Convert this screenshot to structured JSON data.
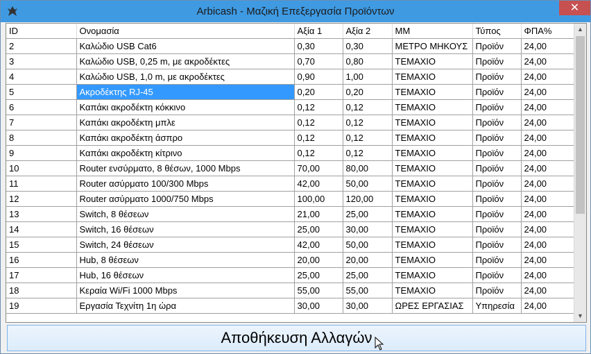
{
  "window": {
    "title": "Arbicash - Μαζική Επεξεργασία Προϊόντων",
    "close_symbol": "✕"
  },
  "grid": {
    "columns": [
      "ID",
      "Ονομασία",
      "Αξία 1",
      "Αξία 2",
      "ΜΜ",
      "Τύπος",
      "ΦΠΑ%"
    ],
    "rows": [
      [
        "2",
        "Καλώδιο USB Cat6",
        "0,30",
        "0,30",
        "ΜΕΤΡΟ ΜΗΚΟΥΣ",
        "Προϊόν",
        "24,00"
      ],
      [
        "3",
        "Καλώδιο USB, 0,25 m, με ακροδέκτες",
        "0,70",
        "0,80",
        "ΤΕΜΑΧΙΟ",
        "Προϊόν",
        "24,00"
      ],
      [
        "4",
        "Καλώδιο USB, 1,0 m, με ακροδέκτες",
        "0,90",
        "1,00",
        "ΤΕΜΑΧΙΟ",
        "Προϊόν",
        "24,00"
      ],
      [
        "5",
        "Ακροδέκτης RJ-45",
        "0,20",
        "0,20",
        "ΤΕΜΑΧΙΟ",
        "Προϊόν",
        "24,00"
      ],
      [
        "6",
        "Καπάκι ακροδέκτη κόκκινο",
        "0,12",
        "0,12",
        "ΤΕΜΑΧΙΟ",
        "Προϊόν",
        "24,00"
      ],
      [
        "7",
        "Καπάκι ακροδέκτη μπλε",
        "0,12",
        "0,12",
        "ΤΕΜΑΧΙΟ",
        "Προϊόν",
        "24,00"
      ],
      [
        "8",
        "Καπάκι ακροδέκτη άσπρο",
        "0,12",
        "0,12",
        "ΤΕΜΑΧΙΟ",
        "Προϊόν",
        "24,00"
      ],
      [
        "9",
        "Καπάκι ακροδέκτη κίτρινο",
        "0,12",
        "0,12",
        "ΤΕΜΑΧΙΟ",
        "Προϊόν",
        "24,00"
      ],
      [
        "10",
        "Router ενσύρματο, 8 θέσων, 1000 Mbps",
        "70,00",
        "80,00",
        "ΤΕΜΑΧΙΟ",
        "Προϊόν",
        "24,00"
      ],
      [
        "11",
        "Router ασύρματο 100/300 Mbps",
        "42,00",
        "50,00",
        "ΤΕΜΑΧΙΟ",
        "Προϊόν",
        "24,00"
      ],
      [
        "12",
        "Router ασύρματο 1000/750 Mbps",
        "100,00",
        "120,00",
        "ΤΕΜΑΧΙΟ",
        "Προϊόν",
        "24,00"
      ],
      [
        "13",
        "Switch, 8 θέσεων",
        "21,00",
        "25,00",
        "ΤΕΜΑΧΙΟ",
        "Προϊόν",
        "24,00"
      ],
      [
        "14",
        "Switch, 16 θέσεων",
        "25,00",
        "30,00",
        "ΤΕΜΑΧΙΟ",
        "Προϊόν",
        "24,00"
      ],
      [
        "15",
        "Switch, 24 θέσεων",
        "42,00",
        "50,00",
        "ΤΕΜΑΧΙΟ",
        "Προϊόν",
        "24,00"
      ],
      [
        "16",
        "Hub, 8 θέσεων",
        "20,00",
        "20,00",
        "ΤΕΜΑΧΙΟ",
        "Προϊόν",
        "24,00"
      ],
      [
        "17",
        "Hub, 16 θέσεων",
        "25,00",
        "25,00",
        "ΤΕΜΑΧΙΟ",
        "Προϊόν",
        "24,00"
      ],
      [
        "18",
        "Κεραία Wi/Fi 1000 Mbps",
        "55,00",
        "55,00",
        "ΤΕΜΑΧΙΟ",
        "Προϊόν",
        "24,00"
      ],
      [
        "19",
        "Εργασία Τεχνίτη 1η ώρα",
        "30,00",
        "30,00",
        "ΩΡΕΣ ΕΡΓΑΣΙΑΣ",
        "Υπηρεσία",
        "24,00"
      ]
    ],
    "selected_row": 3,
    "selected_col": 1
  },
  "save_button": {
    "label": "Αποθήκευση Αλλαγών"
  },
  "colors": {
    "titlebar": "#3f9ae2",
    "selection": "#3399ff",
    "close": "#c75050"
  }
}
